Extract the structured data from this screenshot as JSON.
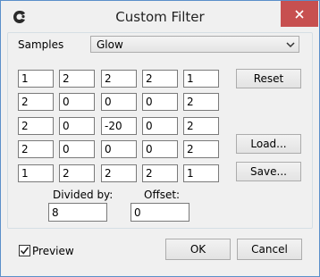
{
  "window": {
    "title": "Custom Filter",
    "close_icon": "close-icon",
    "app_icon": "app-logo-icon"
  },
  "samples": {
    "label": "Samples",
    "selected": "Glow"
  },
  "matrix": [
    [
      "1",
      "2",
      "2",
      "2",
      "1"
    ],
    [
      "2",
      "0",
      "0",
      "0",
      "2"
    ],
    [
      "2",
      "0",
      "-20",
      "0",
      "2"
    ],
    [
      "2",
      "0",
      "0",
      "0",
      "2"
    ],
    [
      "1",
      "2",
      "2",
      "2",
      "1"
    ]
  ],
  "buttons": {
    "reset": "Reset",
    "load": "Load...",
    "save": "Save...",
    "ok": "OK",
    "cancel": "Cancel"
  },
  "divided_by": {
    "label": "Divided by:",
    "value": "8"
  },
  "offset": {
    "label": "Offset:",
    "value": "0"
  },
  "preview": {
    "label": "Preview",
    "checked": true
  },
  "colors": {
    "close_button": "#c75050",
    "window_border": "#5b8fc9"
  }
}
